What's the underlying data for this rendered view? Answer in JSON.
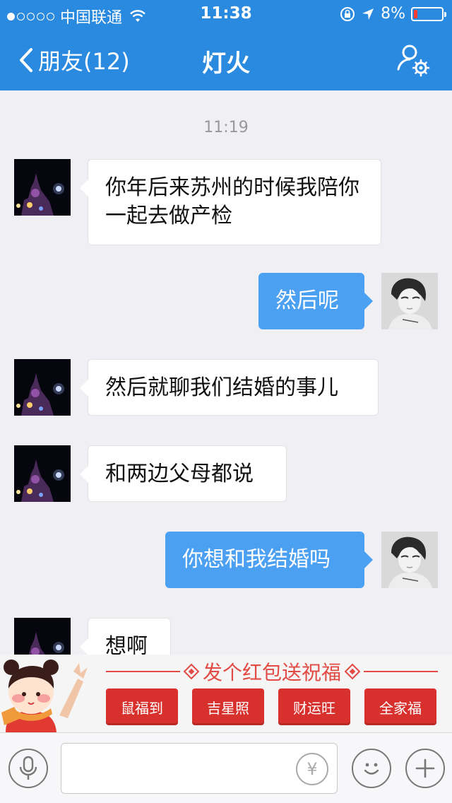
{
  "status_bar": {
    "carrier": "中国联通",
    "time": "11:38",
    "battery": "8%",
    "signal_bars_filled": 1,
    "signal_bars_total": 5
  },
  "nav": {
    "back_label": "朋友(12)",
    "title": "灯火"
  },
  "chat": {
    "timestamp": "11:19",
    "messages": [
      {
        "side": "incoming",
        "text": "你年后来苏州的时候我陪你一起去做产检"
      },
      {
        "side": "outgoing",
        "text": "然后呢"
      },
      {
        "side": "incoming",
        "text": "然后就聊我们结婚的事儿"
      },
      {
        "side": "incoming",
        "text": "和两边父母都说"
      },
      {
        "side": "outgoing",
        "text": "你想和我结婚吗"
      },
      {
        "side": "incoming",
        "text": "想啊"
      }
    ]
  },
  "red_packet": {
    "title": "发个红包送祝福",
    "buttons": [
      "鼠福到",
      "吉星照",
      "财运旺",
      "全家福"
    ]
  },
  "input_bar": {
    "value": "",
    "yen_symbol": "¥"
  },
  "colors": {
    "header": "#2a8ae0",
    "outgoing_bubble": "#4ca0f2",
    "red_accent": "#e24a44",
    "background": "#efeff4"
  },
  "icons": [
    "back-chevron-icon",
    "profile-settings-icon",
    "wifi-icon",
    "lock-rotation-icon",
    "location-arrow-icon",
    "battery-icon",
    "microphone-icon",
    "yen-icon",
    "emoji-icon",
    "plus-icon",
    "diamond-icon",
    "girl-mascot-icon"
  ]
}
